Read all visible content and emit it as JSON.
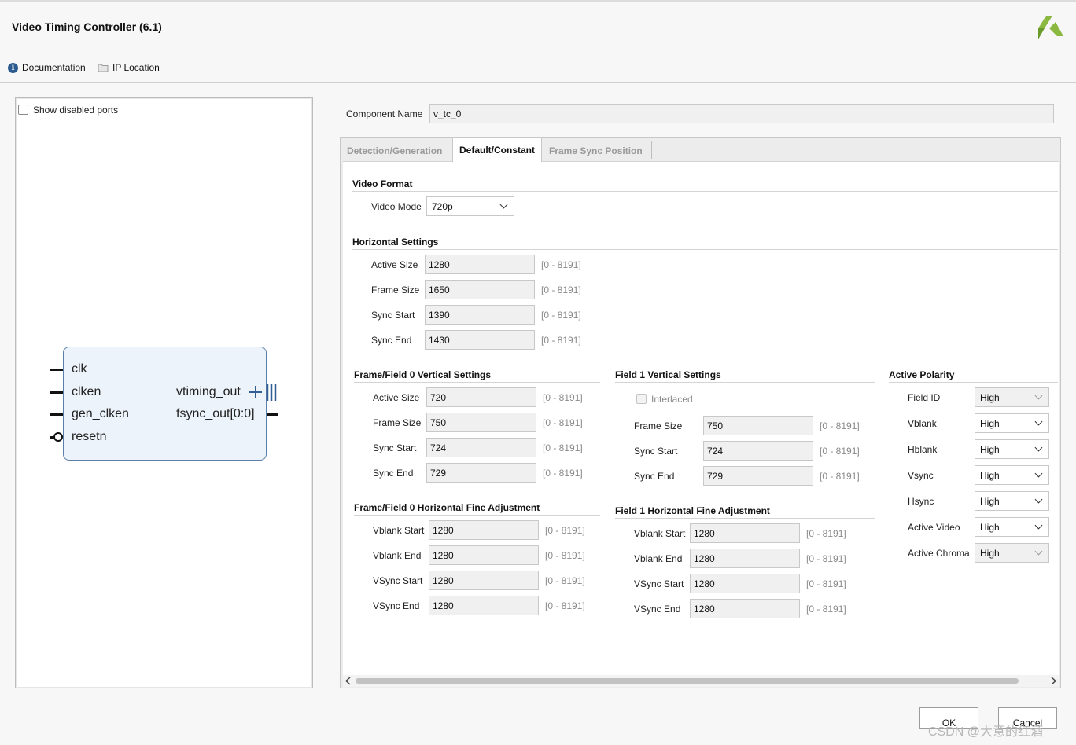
{
  "window": {
    "title": "Video Timing Controller (6.1)"
  },
  "toolbar": {
    "documentation": "Documentation",
    "ip_location": "IP Location"
  },
  "left": {
    "show_disabled_ports": "Show disabled ports",
    "ports_left": [
      "clk",
      "clken",
      "gen_clken",
      "resetn"
    ],
    "ports_right": [
      "vtiming_out",
      "fsync_out[0:0]"
    ]
  },
  "component": {
    "label": "Component Name",
    "value": "v_tc_0"
  },
  "tabs": [
    "Detection/Generation",
    "Default/Constant",
    "Frame Sync Position"
  ],
  "video_format": {
    "title": "Video Format",
    "mode_label": "Video Mode",
    "mode_value": "720p"
  },
  "horizontal": {
    "title": "Horizontal Settings",
    "rows": [
      {
        "label": "Active Size",
        "value": "1280",
        "range": "[0 - 8191]"
      },
      {
        "label": "Frame Size",
        "value": "1650",
        "range": "[0 - 8191]"
      },
      {
        "label": "Sync Start",
        "value": "1390",
        "range": "[0 - 8191]"
      },
      {
        "label": "Sync End",
        "value": "1430",
        "range": "[0 - 8191]"
      }
    ]
  },
  "f0_vertical": {
    "title": "Frame/Field 0 Vertical Settings",
    "rows": [
      {
        "label": "Active Size",
        "value": "720",
        "range": "[0 - 8191]"
      },
      {
        "label": "Frame Size",
        "value": "750",
        "range": "[0 - 8191]"
      },
      {
        "label": "Sync Start",
        "value": "724",
        "range": "[0 - 8191]"
      },
      {
        "label": "Sync End",
        "value": "729",
        "range": "[0 - 8191]"
      }
    ]
  },
  "f1_vertical": {
    "title": "Field 1 Vertical Settings",
    "interlaced": "Interlaced",
    "rows": [
      {
        "label": "Frame Size",
        "value": "750",
        "range": "[0 - 8191]"
      },
      {
        "label": "Sync Start",
        "value": "724",
        "range": "[0 - 8191]"
      },
      {
        "label": "Sync End",
        "value": "729",
        "range": "[0 - 8191]"
      }
    ]
  },
  "f0_hfine": {
    "title": "Frame/Field 0 Horizontal Fine Adjustment",
    "rows": [
      {
        "label": "Vblank Start",
        "value": "1280",
        "range": "[0 - 8191]"
      },
      {
        "label": "Vblank End",
        "value": "1280",
        "range": "[0 - 8191]"
      },
      {
        "label": "VSync Start",
        "value": "1280",
        "range": "[0 - 8191]"
      },
      {
        "label": "VSync End",
        "value": "1280",
        "range": "[0 - 8191]"
      }
    ]
  },
  "f1_hfine": {
    "title": "Field 1 Horizontal Fine Adjustment",
    "rows": [
      {
        "label": "Vblank Start",
        "value": "1280",
        "range": "[0 - 8191]"
      },
      {
        "label": "Vblank End",
        "value": "1280",
        "range": "[0 - 8191]"
      },
      {
        "label": "VSync Start",
        "value": "1280",
        "range": "[0 - 8191]"
      },
      {
        "label": "VSync End",
        "value": "1280",
        "range": "[0 - 8191]"
      }
    ]
  },
  "polarity": {
    "title": "Active Polarity",
    "rows": [
      {
        "label": "Field ID",
        "value": "High"
      },
      {
        "label": "Vblank",
        "value": "High"
      },
      {
        "label": "Hblank",
        "value": "High"
      },
      {
        "label": "Vsync",
        "value": "High"
      },
      {
        "label": "Hsync",
        "value": "High"
      },
      {
        "label": "Active Video",
        "value": "High"
      },
      {
        "label": "Active Chroma",
        "value": "High"
      }
    ]
  },
  "buttons": {
    "ok": "OK",
    "cancel": "Cancel"
  },
  "watermark": "CSDN @大意的红酒"
}
